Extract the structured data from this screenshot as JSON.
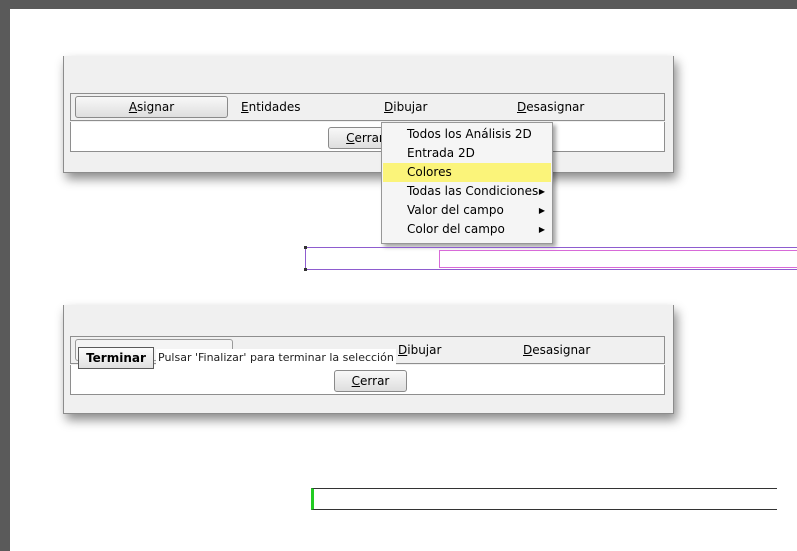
{
  "dialog_top": {
    "buttons": {
      "asignar": {
        "accel": "A",
        "rest": "signar"
      },
      "entidades": {
        "accel": "E",
        "rest": "ntidades"
      },
      "dibujar": {
        "accel": "D",
        "rest": "ibujar"
      },
      "desasignar": {
        "accel": "D",
        "rest": "esasignar"
      }
    },
    "cerrar": {
      "accel": "C",
      "rest": "errar"
    }
  },
  "context_menu": {
    "items": [
      {
        "label": "Todos los Análisis 2D",
        "submenu": false
      },
      {
        "label": "Entrada 2D",
        "submenu": false
      },
      {
        "label": "Colores",
        "submenu": false,
        "highlighted": true
      },
      {
        "label": "Todas las Condiciones",
        "submenu": true
      },
      {
        "label": "Valor del campo",
        "submenu": true
      },
      {
        "label": "Color del campo",
        "submenu": true
      }
    ],
    "submenu_arrow": "▶",
    "highlight_color": "#fbf47a"
  },
  "dialog_bottom": {
    "buttons": {
      "dibujar": {
        "accel": "D",
        "rest": "ibujar"
      },
      "desasignar": {
        "accel": "D",
        "rest": "esasignar"
      }
    },
    "cerrar": {
      "accel": "C",
      "rest": "errar"
    },
    "terminar_button": "Terminar",
    "status_text": "Pulsar 'Finalizar' para terminar la selección"
  },
  "colors": {
    "selection_outline": "#8e5ccf",
    "magenta_bar": "#d86ad8",
    "green_bar": "#22cc22",
    "frame_border": "#5a5a5a"
  }
}
